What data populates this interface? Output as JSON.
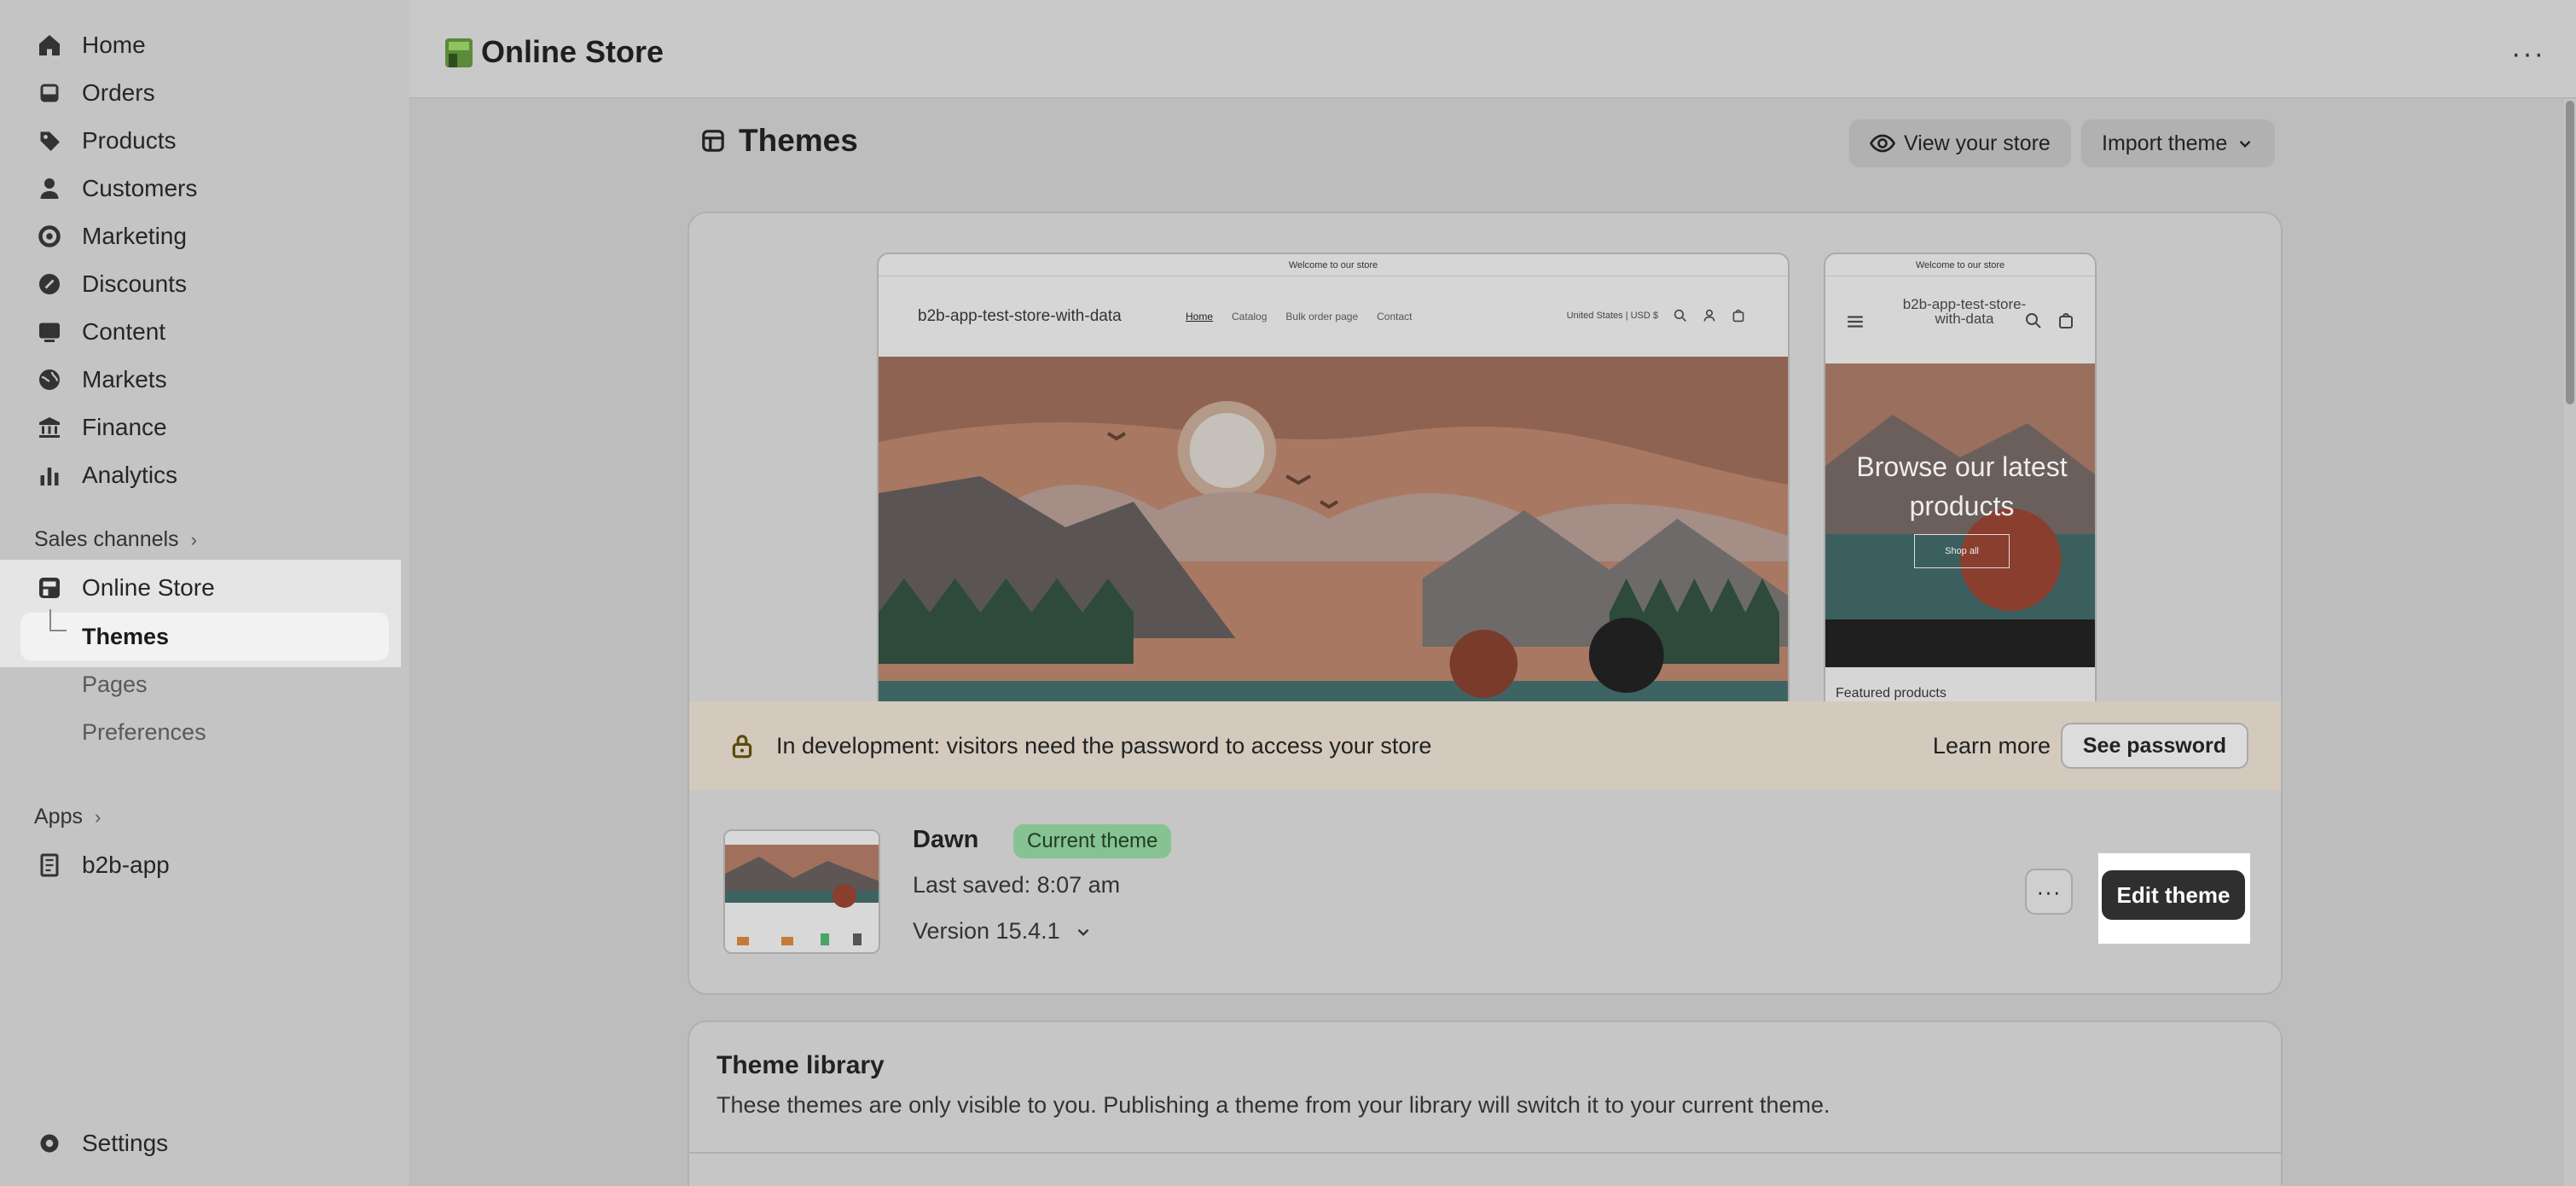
{
  "sidebar": {
    "nav": [
      {
        "label": "Home",
        "icon": "home-icon"
      },
      {
        "label": "Orders",
        "icon": "inbox-icon"
      },
      {
        "label": "Products",
        "icon": "tag-icon"
      },
      {
        "label": "Customers",
        "icon": "person-icon"
      },
      {
        "label": "Marketing",
        "icon": "target-icon"
      },
      {
        "label": "Discounts",
        "icon": "discount-icon"
      },
      {
        "label": "Content",
        "icon": "image-icon"
      },
      {
        "label": "Markets",
        "icon": "globe-icon"
      },
      {
        "label": "Finance",
        "icon": "bank-icon"
      },
      {
        "label": "Analytics",
        "icon": "bar-chart-icon"
      }
    ],
    "sales_channels_label": "Sales channels",
    "online_store_label": "Online Store",
    "sub_items": [
      "Themes",
      "Pages",
      "Preferences"
    ],
    "apps_label": "Apps",
    "app_item": "b2b-app",
    "settings_label": "Settings"
  },
  "topbar": {
    "title": "Online Store",
    "more_label": "···"
  },
  "page": {
    "title": "Themes",
    "view_store_label": "View your store",
    "import_theme_label": "Import theme"
  },
  "preview": {
    "announcement": "Welcome to our store",
    "store_name": "b2b-app-test-store-with-data",
    "links": [
      "Home",
      "Catalog",
      "Bulk order page",
      "Contact"
    ],
    "locale": "United States | USD $",
    "mobile_store_name": "b2b-app-test-store-with-data",
    "mobile_hero_text": "Browse our latest products",
    "mobile_shop_all": "Shop all",
    "mobile_featured": "Featured products"
  },
  "dev_banner": {
    "text": "In development: visitors need the password to access your store",
    "learn_more": "Learn more",
    "see_password": "See password"
  },
  "current_theme": {
    "name": "Dawn",
    "badge": "Current theme",
    "last_saved": "Last saved: 8:07 am",
    "version": "Version 15.4.1",
    "edit_label": "Edit theme",
    "more_label": "···"
  },
  "library": {
    "title": "Theme library",
    "description": "These themes are only visible to you. Publishing a theme from your library will switch it to your current theme."
  },
  "colors": {
    "badge_bg": "#87c292",
    "edit_btn_bg": "#2f2f2f",
    "dev_banner_bg": "#d3cabd"
  }
}
